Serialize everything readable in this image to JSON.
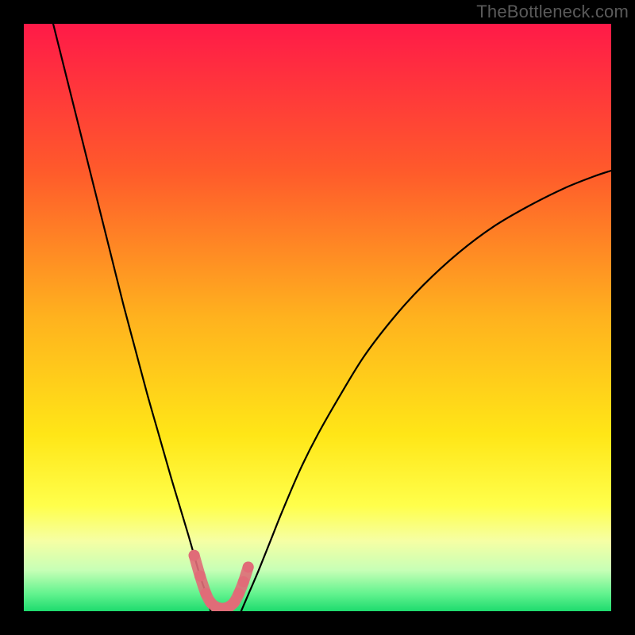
{
  "watermark": "TheBottleneck.com",
  "chart_data": {
    "type": "line",
    "title": "",
    "xlabel": "",
    "ylabel": "",
    "xlim": [
      0,
      100
    ],
    "ylim": [
      0,
      100
    ],
    "background_gradient": {
      "stops": [
        {
          "offset": 0.0,
          "color": "#ff1a48"
        },
        {
          "offset": 0.25,
          "color": "#ff5a2b"
        },
        {
          "offset": 0.5,
          "color": "#ffb21e"
        },
        {
          "offset": 0.7,
          "color": "#ffe617"
        },
        {
          "offset": 0.82,
          "color": "#ffff4b"
        },
        {
          "offset": 0.88,
          "color": "#f6ffa4"
        },
        {
          "offset": 0.93,
          "color": "#c7ffb6"
        },
        {
          "offset": 0.97,
          "color": "#63f38f"
        },
        {
          "offset": 1.0,
          "color": "#1edb6e"
        }
      ]
    },
    "series": [
      {
        "name": "left-curve",
        "type": "line",
        "color": "#000000",
        "x": [
          5.0,
          7.0,
          9.0,
          11.0,
          13.0,
          15.0,
          17.0,
          19.0,
          21.0,
          23.0,
          25.0,
          26.5,
          28.0,
          29.0,
          30.0,
          31.0,
          31.8
        ],
        "y": [
          100.0,
          92.0,
          84.0,
          76.0,
          68.0,
          60.0,
          52.0,
          44.5,
          37.0,
          30.0,
          23.0,
          18.0,
          13.0,
          9.5,
          6.0,
          3.0,
          0.0
        ]
      },
      {
        "name": "right-curve",
        "type": "line",
        "color": "#000000",
        "x": [
          37.0,
          38.5,
          40.0,
          42.0,
          44.0,
          47.0,
          50.0,
          54.0,
          58.0,
          63.0,
          68.0,
          74.0,
          80.0,
          86.0,
          92.0,
          97.0,
          100.0
        ],
        "y": [
          0.0,
          3.5,
          7.0,
          12.0,
          17.0,
          24.0,
          30.0,
          37.0,
          43.5,
          50.0,
          55.5,
          61.0,
          65.5,
          69.0,
          72.0,
          74.0,
          75.0
        ]
      },
      {
        "name": "floor-markers-pink",
        "type": "scatter",
        "color": "#e06c78",
        "x": [
          29.0,
          30.0,
          31.0,
          31.8,
          32.6,
          33.4,
          34.2,
          35.0,
          35.8,
          36.6,
          37.4,
          38.2
        ],
        "y": [
          9.5,
          6.0,
          3.0,
          1.5,
          0.8,
          0.5,
          0.5,
          0.8,
          1.5,
          3.0,
          5.0,
          7.5
        ]
      }
    ]
  }
}
